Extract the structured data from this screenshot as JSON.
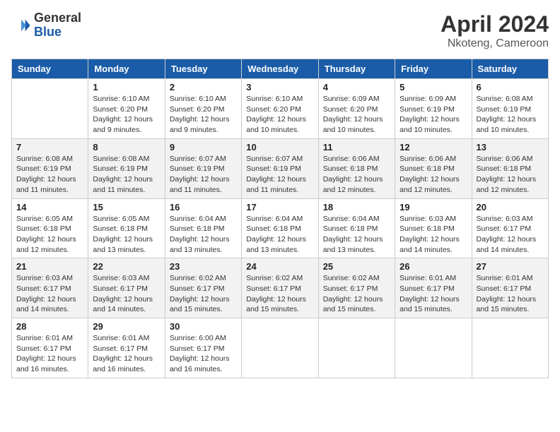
{
  "header": {
    "logo_general": "General",
    "logo_blue": "Blue",
    "month": "April 2024",
    "location": "Nkoteng, Cameroon"
  },
  "days_of_week": [
    "Sunday",
    "Monday",
    "Tuesday",
    "Wednesday",
    "Thursday",
    "Friday",
    "Saturday"
  ],
  "weeks": [
    [
      {
        "day": "",
        "info": ""
      },
      {
        "day": "1",
        "info": "Sunrise: 6:10 AM\nSunset: 6:20 PM\nDaylight: 12 hours\nand 9 minutes."
      },
      {
        "day": "2",
        "info": "Sunrise: 6:10 AM\nSunset: 6:20 PM\nDaylight: 12 hours\nand 9 minutes."
      },
      {
        "day": "3",
        "info": "Sunrise: 6:10 AM\nSunset: 6:20 PM\nDaylight: 12 hours\nand 10 minutes."
      },
      {
        "day": "4",
        "info": "Sunrise: 6:09 AM\nSunset: 6:20 PM\nDaylight: 12 hours\nand 10 minutes."
      },
      {
        "day": "5",
        "info": "Sunrise: 6:09 AM\nSunset: 6:19 PM\nDaylight: 12 hours\nand 10 minutes."
      },
      {
        "day": "6",
        "info": "Sunrise: 6:08 AM\nSunset: 6:19 PM\nDaylight: 12 hours\nand 10 minutes."
      }
    ],
    [
      {
        "day": "7",
        "info": "Sunrise: 6:08 AM\nSunset: 6:19 PM\nDaylight: 12 hours\nand 11 minutes."
      },
      {
        "day": "8",
        "info": "Sunrise: 6:08 AM\nSunset: 6:19 PM\nDaylight: 12 hours\nand 11 minutes."
      },
      {
        "day": "9",
        "info": "Sunrise: 6:07 AM\nSunset: 6:19 PM\nDaylight: 12 hours\nand 11 minutes."
      },
      {
        "day": "10",
        "info": "Sunrise: 6:07 AM\nSunset: 6:19 PM\nDaylight: 12 hours\nand 11 minutes."
      },
      {
        "day": "11",
        "info": "Sunrise: 6:06 AM\nSunset: 6:18 PM\nDaylight: 12 hours\nand 12 minutes."
      },
      {
        "day": "12",
        "info": "Sunrise: 6:06 AM\nSunset: 6:18 PM\nDaylight: 12 hours\nand 12 minutes."
      },
      {
        "day": "13",
        "info": "Sunrise: 6:06 AM\nSunset: 6:18 PM\nDaylight: 12 hours\nand 12 minutes."
      }
    ],
    [
      {
        "day": "14",
        "info": "Sunrise: 6:05 AM\nSunset: 6:18 PM\nDaylight: 12 hours\nand 12 minutes."
      },
      {
        "day": "15",
        "info": "Sunrise: 6:05 AM\nSunset: 6:18 PM\nDaylight: 12 hours\nand 13 minutes."
      },
      {
        "day": "16",
        "info": "Sunrise: 6:04 AM\nSunset: 6:18 PM\nDaylight: 12 hours\nand 13 minutes."
      },
      {
        "day": "17",
        "info": "Sunrise: 6:04 AM\nSunset: 6:18 PM\nDaylight: 12 hours\nand 13 minutes."
      },
      {
        "day": "18",
        "info": "Sunrise: 6:04 AM\nSunset: 6:18 PM\nDaylight: 12 hours\nand 13 minutes."
      },
      {
        "day": "19",
        "info": "Sunrise: 6:03 AM\nSunset: 6:18 PM\nDaylight: 12 hours\nand 14 minutes."
      },
      {
        "day": "20",
        "info": "Sunrise: 6:03 AM\nSunset: 6:17 PM\nDaylight: 12 hours\nand 14 minutes."
      }
    ],
    [
      {
        "day": "21",
        "info": "Sunrise: 6:03 AM\nSunset: 6:17 PM\nDaylight: 12 hours\nand 14 minutes."
      },
      {
        "day": "22",
        "info": "Sunrise: 6:03 AM\nSunset: 6:17 PM\nDaylight: 12 hours\nand 14 minutes."
      },
      {
        "day": "23",
        "info": "Sunrise: 6:02 AM\nSunset: 6:17 PM\nDaylight: 12 hours\nand 15 minutes."
      },
      {
        "day": "24",
        "info": "Sunrise: 6:02 AM\nSunset: 6:17 PM\nDaylight: 12 hours\nand 15 minutes."
      },
      {
        "day": "25",
        "info": "Sunrise: 6:02 AM\nSunset: 6:17 PM\nDaylight: 12 hours\nand 15 minutes."
      },
      {
        "day": "26",
        "info": "Sunrise: 6:01 AM\nSunset: 6:17 PM\nDaylight: 12 hours\nand 15 minutes."
      },
      {
        "day": "27",
        "info": "Sunrise: 6:01 AM\nSunset: 6:17 PM\nDaylight: 12 hours\nand 15 minutes."
      }
    ],
    [
      {
        "day": "28",
        "info": "Sunrise: 6:01 AM\nSunset: 6:17 PM\nDaylight: 12 hours\nand 16 minutes."
      },
      {
        "day": "29",
        "info": "Sunrise: 6:01 AM\nSunset: 6:17 PM\nDaylight: 12 hours\nand 16 minutes."
      },
      {
        "day": "30",
        "info": "Sunrise: 6:00 AM\nSunset: 6:17 PM\nDaylight: 12 hours\nand 16 minutes."
      },
      {
        "day": "",
        "info": ""
      },
      {
        "day": "",
        "info": ""
      },
      {
        "day": "",
        "info": ""
      },
      {
        "day": "",
        "info": ""
      }
    ]
  ]
}
